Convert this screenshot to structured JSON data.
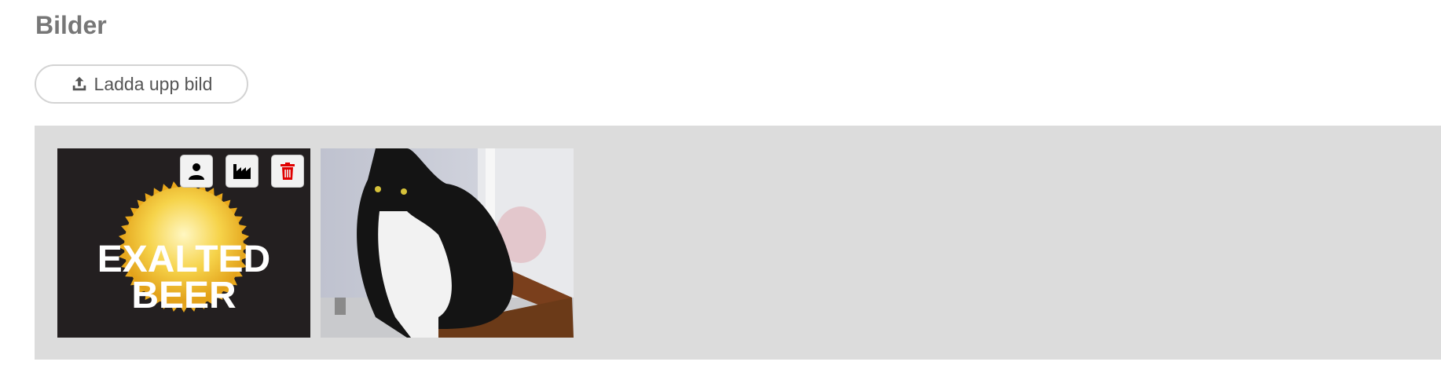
{
  "section": {
    "title": "Bilder"
  },
  "upload": {
    "label": "Ladda upp bild",
    "icon": "upload-icon"
  },
  "gallery": {
    "images": [
      {
        "kind": "logo",
        "logo_text_line1": "EXALTED",
        "logo_text_line2": "BEER",
        "actions": [
          {
            "name": "set-profile-button",
            "icon": "user-icon"
          },
          {
            "name": "set-cover-button",
            "icon": "factory-icon"
          },
          {
            "name": "delete-button",
            "icon": "trash-icon"
          }
        ]
      },
      {
        "kind": "photo",
        "subject": "cat-photo"
      }
    ]
  },
  "colors": {
    "title": "#777777",
    "gallery_bg": "#dcdcdc",
    "delete": "#e00000",
    "logo_bg": "#231f20",
    "sun": "#f4c430"
  }
}
